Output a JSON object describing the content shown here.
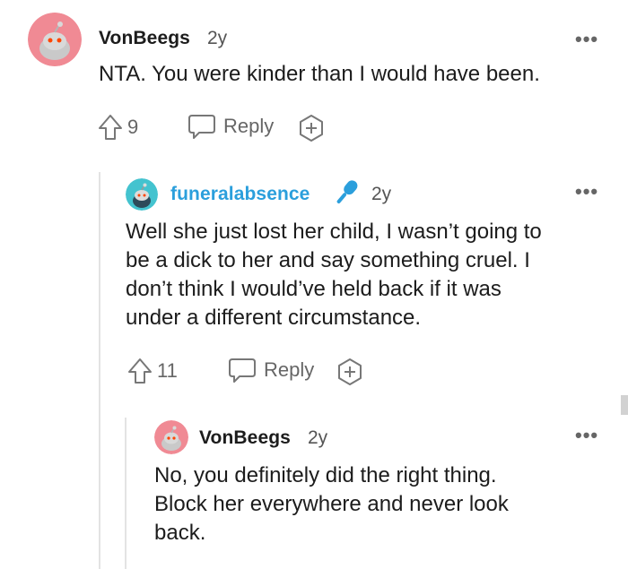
{
  "comments": [
    {
      "username": "VonBeegs",
      "age": "2y",
      "text": "NTA. You were kinder than I would have been.",
      "upvotes": "9",
      "reply_label": "Reply",
      "avatar_color": "#f08a94",
      "more_icon": "more-horizontal-icon"
    },
    {
      "username": "funeralabsence",
      "age": "2y",
      "lines": [
        "Well she just lost her child, I wasn’t going to",
        "be a dick to her and say something cruel. I",
        "don’t think I would’ve held back if it was",
        "under a different circumstance."
      ],
      "upvotes": "11",
      "reply_label": "Reply",
      "avatar_color": "#44c3cf",
      "username_color": "#2b9fdc",
      "badge_icon": "microphone-icon"
    },
    {
      "username": "VonBeegs",
      "age": "2y",
      "lines": [
        "No, you definitely did the right thing.",
        "Block her everywhere and never look",
        "back."
      ],
      "avatar_color": "#f08a94"
    }
  ],
  "more_label": "•••"
}
